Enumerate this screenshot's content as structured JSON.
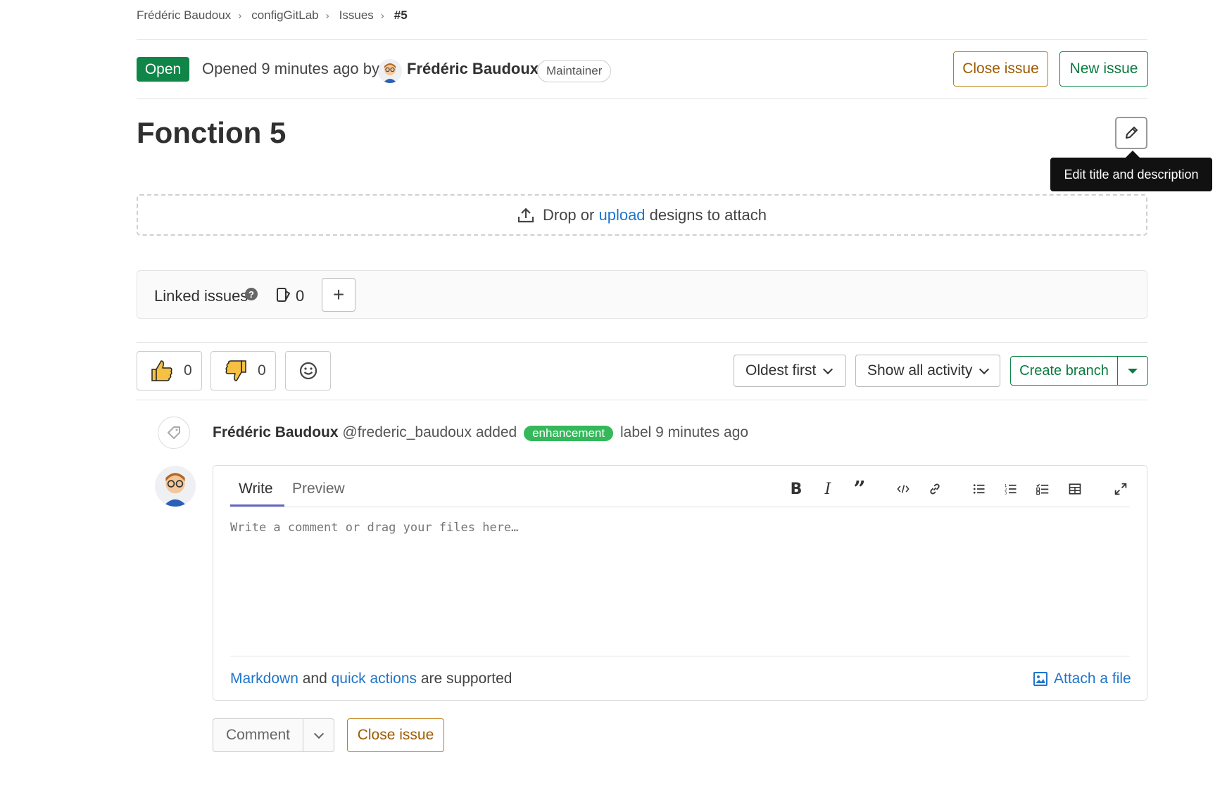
{
  "breadcrumb": {
    "items": [
      "Frédéric Baudoux",
      "configGitLab",
      "Issues"
    ],
    "current": "#5"
  },
  "header": {
    "status": "Open",
    "opened_text": "Opened 9 minutes ago by",
    "author": "Frédéric Baudoux",
    "role": "Maintainer",
    "close_issue_label": "Close issue",
    "new_issue_label": "New issue"
  },
  "issue": {
    "title": "Fonction 5",
    "edit_tooltip": "Edit title and description"
  },
  "designs": {
    "prefix": "Drop or",
    "link": "upload",
    "suffix": "designs to attach"
  },
  "linked_issues": {
    "label": "Linked issues",
    "help": "?",
    "count": "0"
  },
  "awards": {
    "thumbs_up_count": "0",
    "thumbs_down_count": "0"
  },
  "sorting": {
    "order": "Oldest first",
    "filter": "Show all activity",
    "create_branch": "Create branch"
  },
  "activity": {
    "author": "Frédéric Baudoux",
    "handle": "@frederic_baudoux",
    "verb": "added",
    "label": "enhancement",
    "suffix": "label 9 minutes ago"
  },
  "editor": {
    "tab_write": "Write",
    "tab_preview": "Preview",
    "placeholder": "Write a comment or drag your files here…",
    "markdown_link": "Markdown",
    "and_text": "and",
    "quick_actions_link": "quick actions",
    "supported_text": "are supported",
    "attach_label": "Attach a file",
    "tools": [
      "bold-icon",
      "italic-icon",
      "quote-icon",
      "code-icon",
      "link-icon",
      "bullet-list-icon",
      "numbered-list-icon",
      "task-list-icon",
      "table-icon",
      "fullscreen-icon"
    ]
  },
  "actions": {
    "comment_label": "Comment",
    "close_issue_label": "Close issue"
  },
  "colors": {
    "open_badge": "#108548",
    "label_enhancement": "#34b85a",
    "link": "#1f75cb",
    "warning_outline": "#c17d10"
  }
}
